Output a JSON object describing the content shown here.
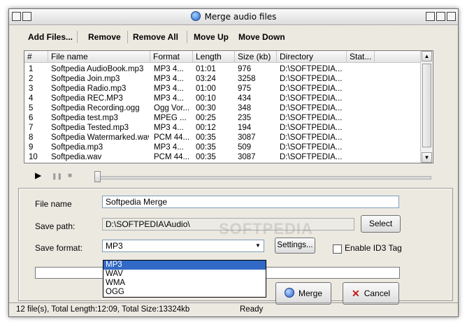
{
  "window": {
    "title": "Merge audio files"
  },
  "toolbar": {
    "add_files": "Add Files...",
    "remove": "Remove",
    "remove_all": "Remove All",
    "move_up": "Move Up",
    "move_down": "Move Down"
  },
  "list": {
    "columns": [
      "#",
      "File name",
      "Format",
      "Length",
      "Size (kb)",
      "Directory",
      "Stat..."
    ],
    "rows": [
      [
        "1",
        "Softpedia AudioBook.mp3",
        "MP3  4...",
        "01:01",
        "976",
        "D:\\SOFTPEDIA..."
      ],
      [
        "2",
        "Softpedia Join.mp3",
        "MP3  4...",
        "03:24",
        "3258",
        "D:\\SOFTPEDIA..."
      ],
      [
        "3",
        "Softpedia Radio.mp3",
        "MP3  4...",
        "01:00",
        "975",
        "D:\\SOFTPEDIA..."
      ],
      [
        "4",
        "Softpedia REC.MP3",
        "MP3  4...",
        "00:10",
        "434",
        "D:\\SOFTPEDIA..."
      ],
      [
        "5",
        "Softpedia Recording.ogg",
        "Ogg Vor...",
        "00:30",
        "348",
        "D:\\SOFTPEDIA..."
      ],
      [
        "6",
        "Softpedia test.mp3",
        "MPEG ...",
        "00:25",
        "235",
        "D:\\SOFTPEDIA..."
      ],
      [
        "7",
        "Softpedia Tested.mp3",
        "MP3  4...",
        "00:12",
        "194",
        "D:\\SOFTPEDIA..."
      ],
      [
        "8",
        "Softpedia Watermarked.wav",
        "PCM 44...",
        "00:35",
        "3087",
        "D:\\SOFTPEDIA..."
      ],
      [
        "9",
        "Softpedia.mp3",
        "MP3  4...",
        "00:35",
        "509",
        "D:\\SOFTPEDIA..."
      ],
      [
        "10",
        "Softpedia.wav",
        "PCM 44...",
        "00:35",
        "3087",
        "D:\\SOFTPEDIA..."
      ]
    ]
  },
  "player": {
    "play": "▶",
    "pause": "❚❚",
    "stop": "■"
  },
  "form": {
    "file_name_label": "File name",
    "file_name_value": "Softpedia Merge",
    "save_path_label": "Save path:",
    "save_path_value": "D:\\SOFTPEDIA\\Audio\\",
    "select_button": "Select",
    "save_format_label": "Save format:",
    "save_format_value": "MP3",
    "format_options": [
      "MP3",
      "WAV",
      "WMA",
      "OGG"
    ],
    "settings_button": "Settings...",
    "enable_id3_label": "Enable ID3 Tag",
    "merge_button": "Merge",
    "cancel_button": "Cancel"
  },
  "status": {
    "left": "12 file(s), Total Length:12:09, Total Size:13324kb",
    "right": "Ready"
  },
  "watermark": "SOFTPEDIA"
}
